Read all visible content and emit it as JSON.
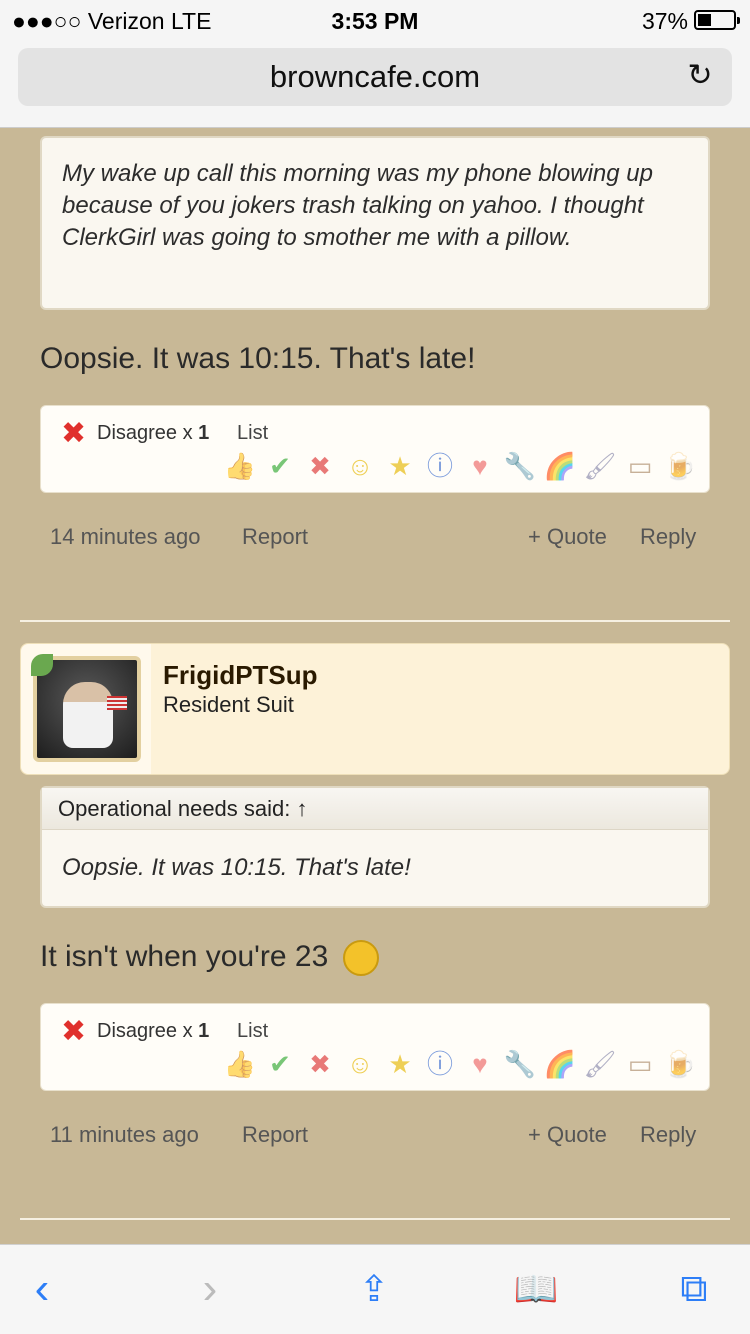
{
  "status": {
    "carrier": "●●●○○ Verizon  LTE",
    "time": "3:53 PM",
    "battery": "37%",
    "battery_level": 0.37
  },
  "browser": {
    "url": "browncafe.com"
  },
  "post1": {
    "quote_text": "My wake up call this morning was my phone blowing up because of you jokers trash talking on yahoo. I thought ClerkGirl was going to smother me with a pillow.",
    "message": "Oopsie. It was 10:15. That's late!",
    "rating_label": "Disagree x ",
    "rating_count": "1",
    "list_label": "List",
    "time_ago": "14 minutes ago",
    "report": "Report",
    "quote": "+ Quote",
    "reply": "Reply"
  },
  "user": {
    "name": "FrigidPTSup",
    "title": "Resident Suit"
  },
  "post2": {
    "quote_header": "Operational needs said: ↑",
    "quote_text": "Oopsie. It was 10:15. That's late!",
    "message": "It isn't when you're 23",
    "rating_label": "Disagree x ",
    "rating_count": "1",
    "list_label": "List",
    "time_ago": "11 minutes ago",
    "report": "Report",
    "quote": "+ Quote",
    "reply": "Reply"
  },
  "rating_icons": [
    "like-icon",
    "agree-icon",
    "disagree-icon",
    "funny-icon",
    "winner-icon",
    "informative-icon",
    "love-icon",
    "useful-icon",
    "creative-icon",
    "paintbrush-icon",
    "box-icon",
    "beer-icon"
  ]
}
